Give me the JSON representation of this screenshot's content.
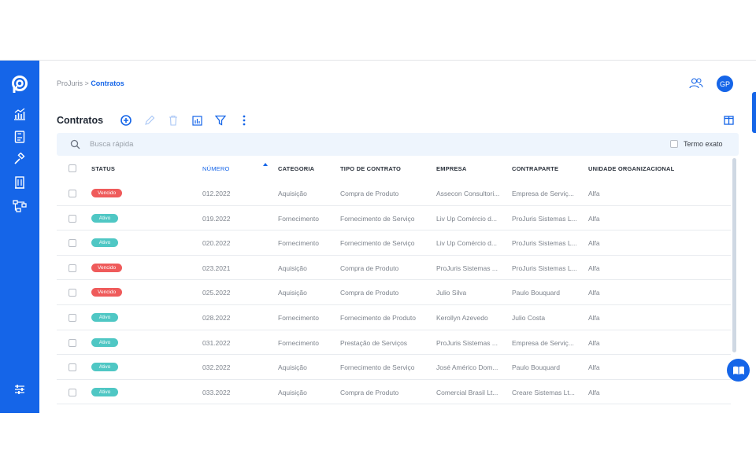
{
  "colors": {
    "primary": "#1565e8",
    "vencido": "#ef5b5b",
    "ativo": "#4fc7c4"
  },
  "breadcrumb": {
    "root": "ProJuris",
    "separator": ">",
    "current": "Contratos"
  },
  "user": {
    "initials": "GP"
  },
  "page": {
    "title": "Contratos"
  },
  "toolbar": [
    "add-icon",
    "edit-icon",
    "trash-icon",
    "chart-icon",
    "filter-icon",
    "more-icon"
  ],
  "search": {
    "placeholder": "Busca rápida",
    "exact_label": "Termo exato"
  },
  "table": {
    "columns": [
      "STATUS",
      "NÚMERO",
      "CATEGORIA",
      "TIPO DE CONTRATO",
      "EMPRESA",
      "CONTRAPARTE",
      "UNIDADE ORGANIZACIONAL"
    ],
    "rows": [
      {
        "status": "Vencido",
        "numero": "012.2022",
        "categoria": "Aquisição",
        "tipo": "Compra de Produto",
        "empresa": "Assecon Consultori...",
        "contraparte": "Empresa de Serviç...",
        "unidade": "Alfa"
      },
      {
        "status": "Ativo",
        "numero": "019.2022",
        "categoria": "Fornecimento",
        "tipo": "Fornecimento de Serviço",
        "empresa": "Liv Up Comércio d...",
        "contraparte": "ProJuris Sistemas L...",
        "unidade": "Alfa"
      },
      {
        "status": "Ativo",
        "numero": "020.2022",
        "categoria": "Fornecimento",
        "tipo": "Fornecimento de Serviço",
        "empresa": "Liv Up Comércio d...",
        "contraparte": "ProJuris Sistemas L...",
        "unidade": "Alfa"
      },
      {
        "status": "Vencido",
        "numero": "023.2021",
        "categoria": "Aquisição",
        "tipo": "Compra de Produto",
        "empresa": "ProJuris Sistemas ...",
        "contraparte": "ProJuris Sistemas L...",
        "unidade": "Alfa"
      },
      {
        "status": "Vencido",
        "numero": "025.2022",
        "categoria": "Aquisição",
        "tipo": "Compra de Produto",
        "empresa": "Julio Silva",
        "contraparte": "Paulo Bouquard",
        "unidade": "Alfa"
      },
      {
        "status": "Ativo",
        "numero": "028.2022",
        "categoria": "Fornecimento",
        "tipo": "Fornecimento de Produto",
        "empresa": "Kerollyn Azevedo",
        "contraparte": "Julio Costa",
        "unidade": "Alfa"
      },
      {
        "status": "Ativo",
        "numero": "031.2022",
        "categoria": "Fornecimento",
        "tipo": "Prestação de Serviços",
        "empresa": "ProJuris Sistemas ...",
        "contraparte": "Empresa de Serviç...",
        "unidade": "Alfa"
      },
      {
        "status": "Ativo",
        "numero": "032.2022",
        "categoria": "Aquisição",
        "tipo": "Fornecimento de Serviço",
        "empresa": "José Américo Dom...",
        "contraparte": "Paulo Bouquard",
        "unidade": "Alfa"
      },
      {
        "status": "Ativo",
        "numero": "033.2022",
        "categoria": "Aquisição",
        "tipo": "Compra de Produto",
        "empresa": "Comercial Brasil Lt...",
        "contraparte": "Creare Sistemas Lt...",
        "unidade": "Alfa"
      }
    ]
  },
  "sidebar": [
    "logo-icon",
    "dashboard-icon",
    "contracts-icon",
    "gavel-icon",
    "building-icon",
    "workflow-icon",
    "settings-icon"
  ]
}
